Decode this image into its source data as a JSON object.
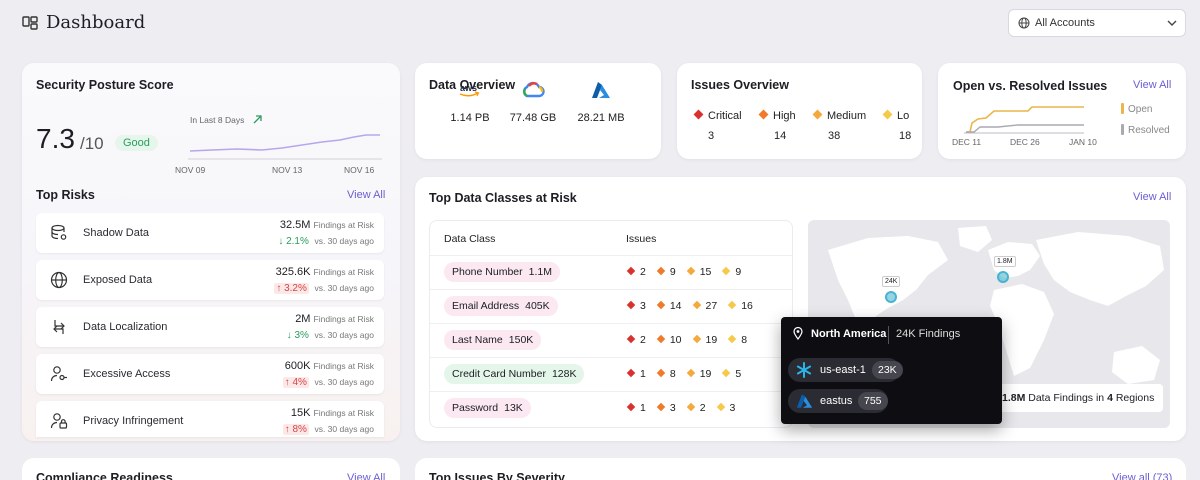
{
  "header": {
    "title": "Dashboard",
    "accounts_label": "All Accounts"
  },
  "posture": {
    "title": "Security Posture Score",
    "score": "7.3",
    "score_den": "/10",
    "badge": "Good",
    "trend_label": "In Last 8 Days",
    "x_labels": [
      "NOV 09",
      "NOV 13",
      "NOV 16"
    ]
  },
  "top_risks": {
    "title": "Top Risks",
    "view_all": "View All",
    "findings_label": "Findings at Risk",
    "vs_label": "vs. 30 days ago",
    "items": [
      {
        "name": "Shadow Data",
        "value": "32.5M",
        "change": "2.1%",
        "dir": "down",
        "icon": "database-eye-icon"
      },
      {
        "name": "Exposed Data",
        "value": "325.6K",
        "change": "3.2%",
        "dir": "up",
        "icon": "globe-icon"
      },
      {
        "name": "Data Localization",
        "value": "2M",
        "change": "3%",
        "dir": "down",
        "icon": "transfer-icon"
      },
      {
        "name": "Excessive Access",
        "value": "600K",
        "change": "4%",
        "dir": "up",
        "icon": "user-key-icon"
      },
      {
        "name": "Privacy Infringement",
        "value": "15K",
        "change": "8%",
        "dir": "up",
        "icon": "user-lock-icon"
      }
    ]
  },
  "data_overview": {
    "title": "Data Overview",
    "items": [
      {
        "logo": "aws",
        "value": "1.14 PB"
      },
      {
        "logo": "gcp",
        "value": "77.48 GB"
      },
      {
        "logo": "azure",
        "value": "28.21 MB"
      }
    ]
  },
  "issues_overview": {
    "title": "Issues Overview",
    "items": [
      {
        "label": "Critical",
        "value": "3",
        "color": "#d9322e"
      },
      {
        "label": "High",
        "value": "14",
        "color": "#f07a2a"
      },
      {
        "label": "Medium",
        "value": "38",
        "color": "#f4a93a"
      },
      {
        "label": "Lo",
        "value": "18",
        "color": "#f6c94a"
      }
    ]
  },
  "open_resolved": {
    "title": "Open vs. Resolved Issues",
    "view_all": "View All",
    "x_labels": [
      "DEC 11",
      "DEC 26",
      "JAN 10"
    ],
    "legend_open": "Open",
    "legend_resolved": "Resolved",
    "colors": {
      "open": "#e8b64a",
      "resolved": "#a9a9b0"
    }
  },
  "data_classes": {
    "title": "Top Data Classes at Risk",
    "view_all": "View All",
    "col_class": "Data Class",
    "col_issues": "Issues",
    "rows": [
      {
        "name": "Phone Number",
        "count": "1.1M",
        "style": "pink",
        "c": "2",
        "h": "9",
        "m": "15",
        "l": "9"
      },
      {
        "name": "Email Address",
        "count": "405K",
        "style": "pink",
        "c": "3",
        "h": "14",
        "m": "27",
        "l": "16"
      },
      {
        "name": "Last Name",
        "count": "150K",
        "style": "pink",
        "c": "2",
        "h": "10",
        "m": "19",
        "l": "8"
      },
      {
        "name": "Credit Card Number",
        "count": "128K",
        "style": "green",
        "c": "1",
        "h": "8",
        "m": "19",
        "l": "5"
      },
      {
        "name": "Password",
        "count": "13K",
        "style": "pink",
        "c": "1",
        "h": "3",
        "m": "2",
        "l": "3"
      }
    ]
  },
  "map": {
    "bubble_na": "24K",
    "bubble_eu": "1.8M",
    "tooltip": {
      "region": "North America",
      "findings": "24K Findings",
      "items": [
        {
          "name": "us-east-1",
          "count": "23K",
          "icon": "snowflake-icon"
        },
        {
          "name": "eastus",
          "count": "755",
          "icon": "azure-icon"
        }
      ]
    },
    "summary_value": "1.8M",
    "summary_mid": " Data Findings in ",
    "summary_regions": "4",
    "summary_end": " Regions"
  },
  "bottom": {
    "compliance_title": "Compliance Readiness",
    "compliance_view_all": "View All",
    "issues_title": "Top Issues By Severity",
    "issues_view_all": "View all (73)"
  }
}
